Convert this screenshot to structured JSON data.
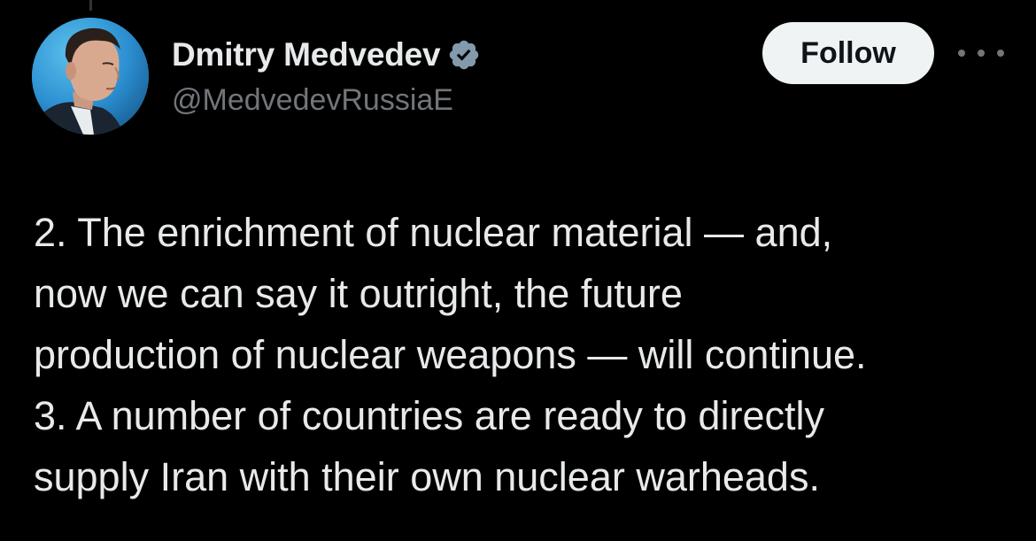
{
  "author": {
    "display_name": "Dmitry Medvedev",
    "handle": "@MedvedevRussiaE",
    "verified": true,
    "verified_icon": "verified-badge-icon",
    "avatar_icon": "profile-photo"
  },
  "actions": {
    "follow_label": "Follow",
    "more_icon": "more-options-icon"
  },
  "tweet": {
    "lines": [
      "2. The enrichment of nuclear material — and,",
      "now we can say it outright, the future",
      "production of nuclear weapons — will continue.",
      "3. A number of countries are ready to directly",
      "supply Iran with their own nuclear warheads."
    ]
  },
  "colors": {
    "background": "#000000",
    "primary_text": "#e7e9ea",
    "secondary_text": "#71767b",
    "follow_bg": "#eff3f4",
    "follow_text": "#0f1419"
  }
}
